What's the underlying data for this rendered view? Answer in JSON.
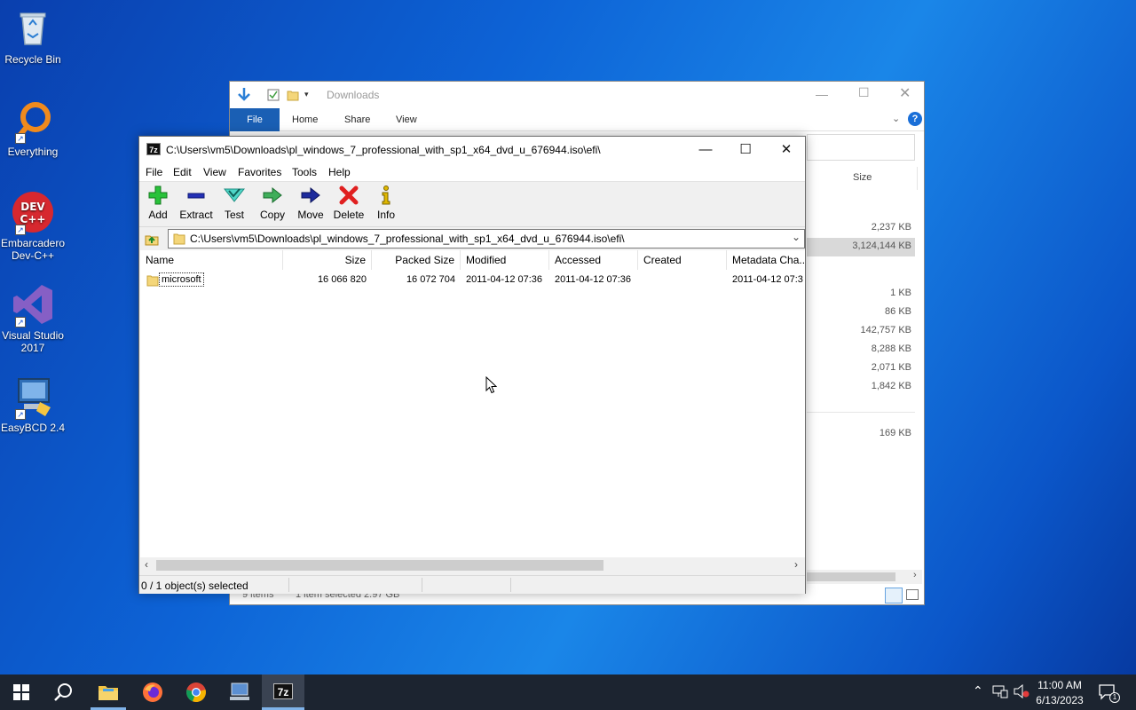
{
  "desktop": {
    "icons": [
      {
        "label": "Recycle Bin"
      },
      {
        "label": "Everything"
      },
      {
        "label": "Embarcadero Dev-C++"
      },
      {
        "label": "Visual Studio 2017"
      },
      {
        "label": "EasyBCD 2.4"
      }
    ]
  },
  "explorer": {
    "title": "Downloads",
    "tabs": [
      "File",
      "Home",
      "Share",
      "View"
    ],
    "size_header": "Size",
    "sizes": [
      "2,237 KB",
      "3,124,144 KB",
      "1 KB",
      "86 KB",
      "142,757 KB",
      "8,288 KB",
      "2,071 KB",
      "1,842 KB",
      "169 KB"
    ],
    "status_items": "9 items",
    "status_selected": "1 item selected  2.97 GB"
  },
  "zip": {
    "title": "C:\\Users\\vm5\\Downloads\\pl_windows_7_professional_with_sp1_x64_dvd_u_676944.iso\\efi\\",
    "menu": [
      "File",
      "Edit",
      "View",
      "Favorites",
      "Tools",
      "Help"
    ],
    "toolbar": {
      "add": "Add",
      "extract": "Extract",
      "test": "Test",
      "copy": "Copy",
      "move": "Move",
      "delete": "Delete",
      "info": "Info"
    },
    "address": "C:\\Users\\vm5\\Downloads\\pl_windows_7_professional_with_sp1_x64_dvd_u_676944.iso\\efi\\",
    "columns": [
      "Name",
      "Size",
      "Packed Size",
      "Modified",
      "Accessed",
      "Created",
      "Metadata Cha..."
    ],
    "rows": [
      {
        "name": "microsoft",
        "size": "16 066 820",
        "packed": "16 072 704",
        "modified": "2011-04-12 07:36",
        "accessed": "2011-04-12 07:36",
        "created": "",
        "metadata": "2011-04-12 07:3"
      }
    ],
    "status": "0 / 1 object(s) selected"
  },
  "taskbar": {
    "time": "11:00 AM",
    "date": "6/13/2023",
    "notification_count": "1"
  },
  "colors": {
    "accent": "#1a5fb4",
    "taskbar": "#1c2430",
    "folder": "#f4d67a"
  }
}
